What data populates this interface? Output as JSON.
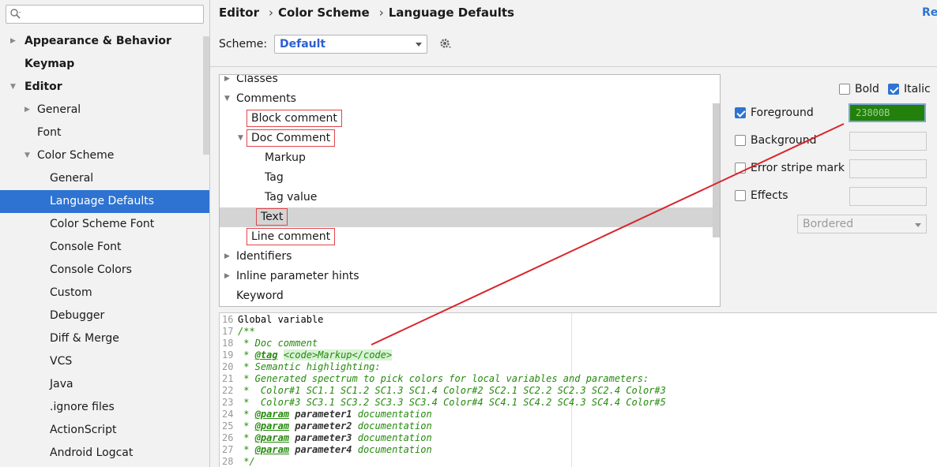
{
  "sidebar": {
    "search": {
      "value": "",
      "placeholder": ""
    },
    "items": [
      {
        "label": "Appearance & Behavior",
        "bold": true,
        "arrow": "right"
      },
      {
        "label": "Keymap",
        "bold": true
      },
      {
        "label": "Editor",
        "bold": true,
        "arrow": "down"
      },
      {
        "label": "General",
        "arrow": "right"
      },
      {
        "label": "Font"
      },
      {
        "label": "Color Scheme",
        "arrow": "down"
      },
      {
        "label": "General"
      },
      {
        "label": "Language Defaults",
        "selected": true
      },
      {
        "label": "Color Scheme Font"
      },
      {
        "label": "Console Font"
      },
      {
        "label": "Console Colors"
      },
      {
        "label": "Custom"
      },
      {
        "label": "Debugger"
      },
      {
        "label": "Diff & Merge"
      },
      {
        "label": "VCS"
      },
      {
        "label": "Java"
      },
      {
        "label": ".ignore files"
      },
      {
        "label": "ActionScript"
      },
      {
        "label": "Android Logcat"
      }
    ]
  },
  "header": {
    "breadcrumb": [
      "Editor",
      "Color Scheme",
      "Language Defaults"
    ],
    "separator": "›",
    "reset_label": "Res",
    "scheme_label": "Scheme:",
    "scheme_value": "Default"
  },
  "attr_tree": {
    "items": [
      {
        "label": "Classes",
        "arrow": "right"
      },
      {
        "label": "Comments",
        "arrow": "down"
      },
      {
        "label": "Block comment",
        "highlighted": true
      },
      {
        "label": "Doc Comment",
        "arrow": "down",
        "highlighted": true
      },
      {
        "label": "Markup"
      },
      {
        "label": "Tag"
      },
      {
        "label": "Tag value"
      },
      {
        "label": "Text",
        "selected": true,
        "highlighted": true
      },
      {
        "label": "Line comment",
        "highlighted": true
      },
      {
        "label": "Identifiers",
        "arrow": "right"
      },
      {
        "label": "Inline parameter hints",
        "arrow": "right"
      },
      {
        "label": "Keyword"
      }
    ]
  },
  "options": {
    "bold": {
      "label": "Bold",
      "checked": false
    },
    "italic": {
      "label": "Italic",
      "checked": true
    },
    "foreground": {
      "label": "Foreground",
      "checked": true,
      "color": "23800B"
    },
    "background": {
      "label": "Background",
      "checked": false
    },
    "error_stripe": {
      "label": "Error stripe mark",
      "checked": false
    },
    "effects": {
      "label": "Effects",
      "checked": false
    },
    "effect_type": "Bordered"
  },
  "colors": {
    "accent": "#2e73d2",
    "comment_green": "#23800b",
    "highlight_red": "#e0454a"
  },
  "preview": {
    "lines": [
      {
        "n": "16",
        "text": "Global variable",
        "plain": true
      },
      {
        "n": "17",
        "text": "/**"
      },
      {
        "n": "18",
        "text": " * Doc comment"
      },
      {
        "n": "19",
        "tag": "@tag",
        "code": "<code>Markup</code>",
        "pre": " * "
      },
      {
        "n": "20",
        "text": " * Semantic highlighting:"
      },
      {
        "n": "21",
        "text": " * Generated spectrum to pick colors for local variables and parameters:"
      },
      {
        "n": "22",
        "text": " *  Color#1 SC1.1 SC1.2 SC1.3 SC1.4 Color#2 SC2.1 SC2.2 SC2.3 SC2.4 Color#3"
      },
      {
        "n": "23",
        "text": " *  Color#3 SC3.1 SC3.2 SC3.3 SC3.4 Color#4 SC4.1 SC4.2 SC4.3 SC4.4 Color#5"
      },
      {
        "n": "24",
        "tag": "@param",
        "param": "parameter1",
        "doc": "documentation",
        "pre": " * "
      },
      {
        "n": "25",
        "tag": "@param",
        "param": "parameter2",
        "doc": "documentation",
        "pre": " * "
      },
      {
        "n": "26",
        "tag": "@param",
        "param": "parameter3",
        "doc": "documentation",
        "pre": " * "
      },
      {
        "n": "27",
        "tag": "@param",
        "param": "parameter4",
        "doc": "documentation",
        "pre": " * "
      },
      {
        "n": "28",
        "text": " */"
      }
    ]
  }
}
